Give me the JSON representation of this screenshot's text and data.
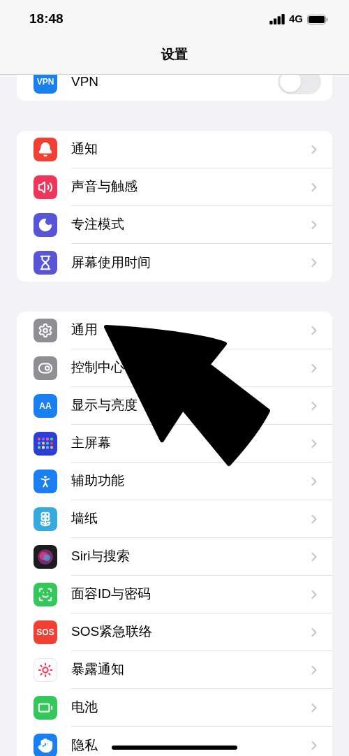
{
  "status_bar": {
    "time": "18:48",
    "network": "4G"
  },
  "title": "设置",
  "groups": [
    {
      "rows": [
        {
          "label": "VPN",
          "color": "#1a7ff0",
          "icon_text": "VPN",
          "kind": "toggle",
          "on": false
        }
      ]
    },
    {
      "rows": [
        {
          "label": "通知",
          "color": "#f04034",
          "kind": "link"
        },
        {
          "label": "声音与触感",
          "color": "#f0355a",
          "kind": "link"
        },
        {
          "label": "专注模式",
          "color": "#5856d6",
          "kind": "link"
        },
        {
          "label": "屏幕使用时间",
          "color": "#5856d6",
          "kind": "link"
        }
      ]
    },
    {
      "rows": [
        {
          "label": "通用",
          "color": "#8e8e93",
          "kind": "link"
        },
        {
          "label": "控制中心",
          "color": "#8e8e93",
          "kind": "link"
        },
        {
          "label": "显示与亮度",
          "color": "#1a7ff0",
          "icon_text": "AA",
          "kind": "link"
        },
        {
          "label": "主屏幕",
          "color": "#2b3fd6",
          "kind": "link"
        },
        {
          "label": "辅助功能",
          "color": "#1a7ff0",
          "kind": "link"
        },
        {
          "label": "墙纸",
          "color": "#36aadc",
          "kind": "link"
        },
        {
          "label": "Siri与搜索",
          "color": "#1c1c1e",
          "kind": "link"
        },
        {
          "label": "面容ID与密码",
          "color": "#34c759",
          "kind": "link"
        },
        {
          "label": "SOS紧急联络",
          "color": "#f04034",
          "icon_text": "SOS",
          "kind": "link"
        },
        {
          "label": "暴露通知",
          "color": "#ffffff",
          "kind": "link"
        },
        {
          "label": "电池",
          "color": "#34c759",
          "kind": "link"
        },
        {
          "label": "隐私",
          "color": "#1a7ff0",
          "kind": "link"
        }
      ]
    }
  ]
}
